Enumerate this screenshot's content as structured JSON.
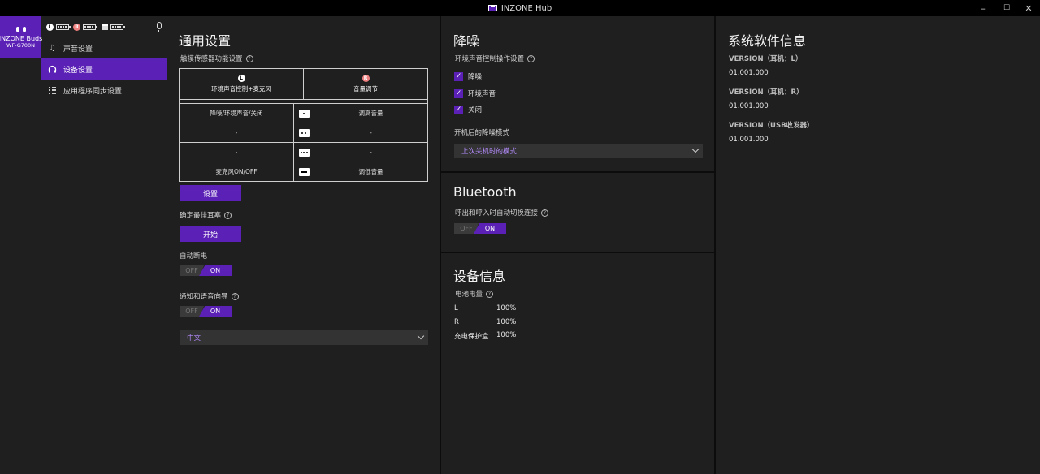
{
  "window": {
    "title": "INZONE Hub",
    "minimize": "–",
    "maximize": "☐",
    "close": "✕"
  },
  "device": {
    "name": "INZONE Buds",
    "model": "WF-G700N"
  },
  "status": {
    "left_label": "L",
    "right_label": "R"
  },
  "nav": {
    "items": [
      {
        "label": "声音设置"
      },
      {
        "label": "设备设置"
      },
      {
        "label": "应用程序同步设置"
      }
    ]
  },
  "general": {
    "title": "通用设置",
    "touch_sensor_label": "触摸传感器功能设置",
    "left_head_mark": "L",
    "left_head_label": "环境声音控制+麦克风",
    "right_head_mark": "R",
    "right_head_label": "音量调节",
    "rows": [
      {
        "left": "降噪/环境声音/关闭",
        "right": "调高音量"
      },
      {
        "left": "-",
        "right": "-"
      },
      {
        "left": "-",
        "right": "-"
      },
      {
        "left": "麦克风ON/OFF",
        "right": "调低音量"
      }
    ],
    "setup_button": "设置",
    "best_fit_label": "确定最佳耳塞",
    "start_button": "开始",
    "auto_off_label": "自动断电",
    "auto_off_off": "OFF",
    "auto_off_on": "ON",
    "voice_guide_label": "通知和语音向导",
    "voice_guide_off": "OFF",
    "voice_guide_on": "ON",
    "language_value": "中文"
  },
  "nc": {
    "title": "降噪",
    "ambient_control_label": "环境声音控制操作设置",
    "options": [
      {
        "label": "降噪"
      },
      {
        "label": "环境声音"
      },
      {
        "label": "关闭"
      }
    ],
    "startup_mode_label": "开机后的降噪模式",
    "startup_mode_value": "上次关机时的模式"
  },
  "bluetooth": {
    "title": "Bluetooth",
    "auto_switch_label": "呼出和呼入时自动切换连接",
    "off": "OFF",
    "on": "ON"
  },
  "device_info": {
    "title": "设备信息",
    "battery_label": "电池电量",
    "items": [
      {
        "name": "L",
        "value": "100%"
      },
      {
        "name": "R",
        "value": "100%"
      },
      {
        "name": "充电保护盒",
        "value": "100%"
      }
    ]
  },
  "software": {
    "title": "系统软件信息",
    "versions": [
      {
        "label": "VERSION（耳机：L）",
        "value": "01.001.000"
      },
      {
        "label": "VERSION（耳机：R）",
        "value": "01.001.000"
      },
      {
        "label": "VERSION（USB收发器）",
        "value": "01.001.000"
      }
    ]
  },
  "colors": {
    "accent": "#5b21b6",
    "background": "#1f1f1f",
    "titlebar": "#000000"
  }
}
